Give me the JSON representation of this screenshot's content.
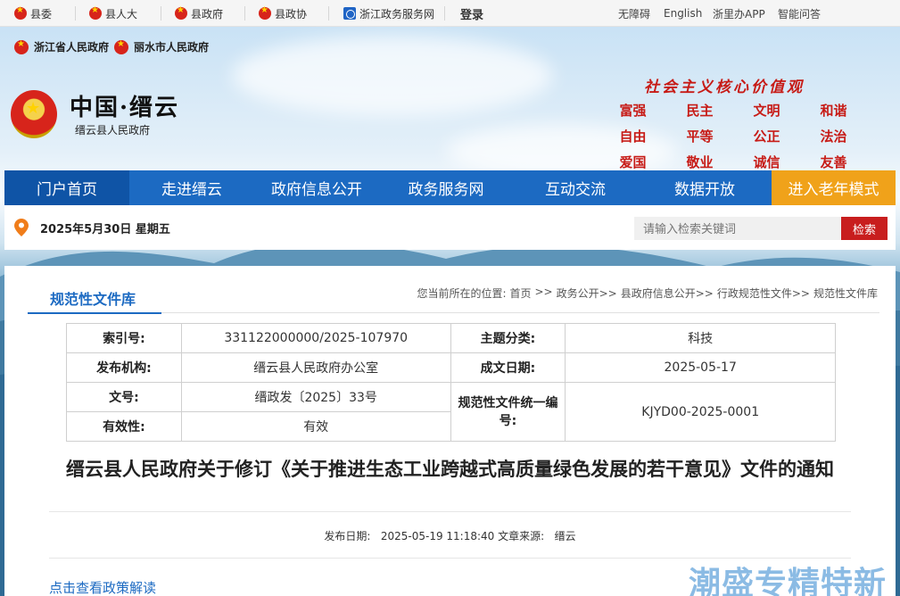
{
  "topbar": {
    "links": [
      {
        "label": "县委"
      },
      {
        "label": "县人大"
      },
      {
        "label": "县政府"
      },
      {
        "label": "县政协"
      },
      {
        "label": "浙江政务服务网"
      }
    ],
    "login": "登录",
    "right": [
      "无障碍",
      "English",
      "浙里办APP",
      "智能问答"
    ]
  },
  "header": {
    "province": "浙江省人民政府",
    "city": "丽水市人民政府",
    "site_title": "中国·缙云",
    "site_subtitle": "缙云县人民政府",
    "values_title": "社会主义核心价值观",
    "values": [
      "富强",
      "民主",
      "文明",
      "和谐",
      "自由",
      "平等",
      "公正",
      "法治",
      "爱国",
      "敬业",
      "诚信",
      "友善"
    ]
  },
  "nav": {
    "items": [
      "门户首页",
      "走进缙云",
      "政府信息公开",
      "政务服务网",
      "互动交流",
      "数据开放",
      "进入老年模式"
    ]
  },
  "infobar": {
    "date": "2025年5月30日 星期五",
    "search_placeholder": "请输入检索关键词",
    "search_button": "检索"
  },
  "section": {
    "title": "规范性文件库",
    "breadcrumb": [
      "您当前所在的位置:",
      "首页",
      ">>",
      "政务公开>>",
      "县政府信息公开>>",
      "行政规范性文件>>",
      "规范性文件库"
    ]
  },
  "meta": {
    "index_label": "索引号:",
    "index_value": "331122000000/2025-107970",
    "topic_label": "主题分类:",
    "topic_value": "科技",
    "org_label": "发布机构:",
    "org_value": "缙云县人民政府办公室",
    "date_label": "成文日期:",
    "date_value": "2025-05-17",
    "docno_label": "文号:",
    "docno_value": "缙政发〔2025〕33号",
    "unified_label": "规范性文件统一编号:",
    "unified_value": "KJYD00-2025-0001",
    "validity_label": "有效性:",
    "validity_value": "有效"
  },
  "document": {
    "title": "缙云县人民政府关于修订《关于推进生态工业跨越式高质量绿色发展的若干意见》文件的通知",
    "pub_label": "发布日期:",
    "pub_value": "2025-05-19 11:18:40",
    "source_label": "文章来源:",
    "source_value": "缙云",
    "policy_link": "点击查看政策解读"
  },
  "watermark": "潮盛专精特新",
  "colors": {
    "nav_blue": "#1c6ac2",
    "old_mode": "#f0a21a",
    "values_red": "#c71b16",
    "search_red": "#c81e1e"
  }
}
